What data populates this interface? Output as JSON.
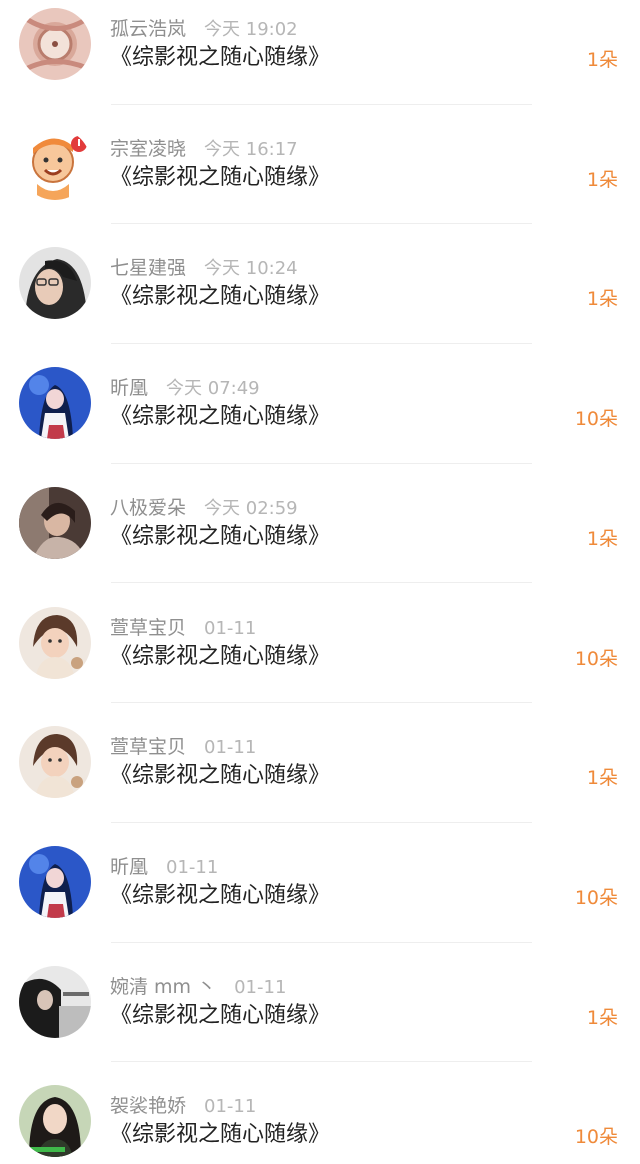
{
  "items": [
    {
      "name": "孤云浩岚",
      "time": "今天 19:02",
      "title": "《综影视之随心随缘》",
      "amount": "1朵",
      "avatar": "watch-avatar"
    },
    {
      "name": "宗室凌晓",
      "time": "今天 16:17",
      "title": "《综影视之随心随缘》",
      "amount": "1朵",
      "avatar": "cartoon-boy-avatar"
    },
    {
      "name": "七星建强",
      "time": "今天 10:24",
      "title": "《综影视之随心随缘》",
      "amount": "1朵",
      "avatar": "girl-glasses-avatar"
    },
    {
      "name": "昕凰",
      "time": "今天 07:49",
      "title": "《综影视之随心随缘》",
      "amount": "10朵",
      "avatar": "anime-girl-avatar"
    },
    {
      "name": "八极爱朵",
      "time": "今天 02:59",
      "title": "《综影视之随心随缘》",
      "amount": "1朵",
      "avatar": "person-photo-avatar"
    },
    {
      "name": "萱草宝贝",
      "time": "01-11",
      "title": "《综影视之随心随缘》",
      "amount": "10朵",
      "avatar": "child-photo-avatar"
    },
    {
      "name": "萱草宝贝",
      "time": "01-11",
      "title": "《综影视之随心随缘》",
      "amount": "1朵",
      "avatar": "child-photo-avatar"
    },
    {
      "name": "昕凰",
      "time": "01-11",
      "title": "《综影视之随心随缘》",
      "amount": "10朵",
      "avatar": "anime-girl-avatar"
    },
    {
      "name": "婉清 mm 丶",
      "time": "01-11",
      "title": "《综影视之随心随缘》",
      "amount": "1朵",
      "avatar": "dark-photo-avatar"
    },
    {
      "name": "袈裟艳娇",
      "time": "01-11",
      "title": "《综影视之随心随缘》",
      "amount": "10朵",
      "avatar": "woman-photo-avatar"
    }
  ]
}
